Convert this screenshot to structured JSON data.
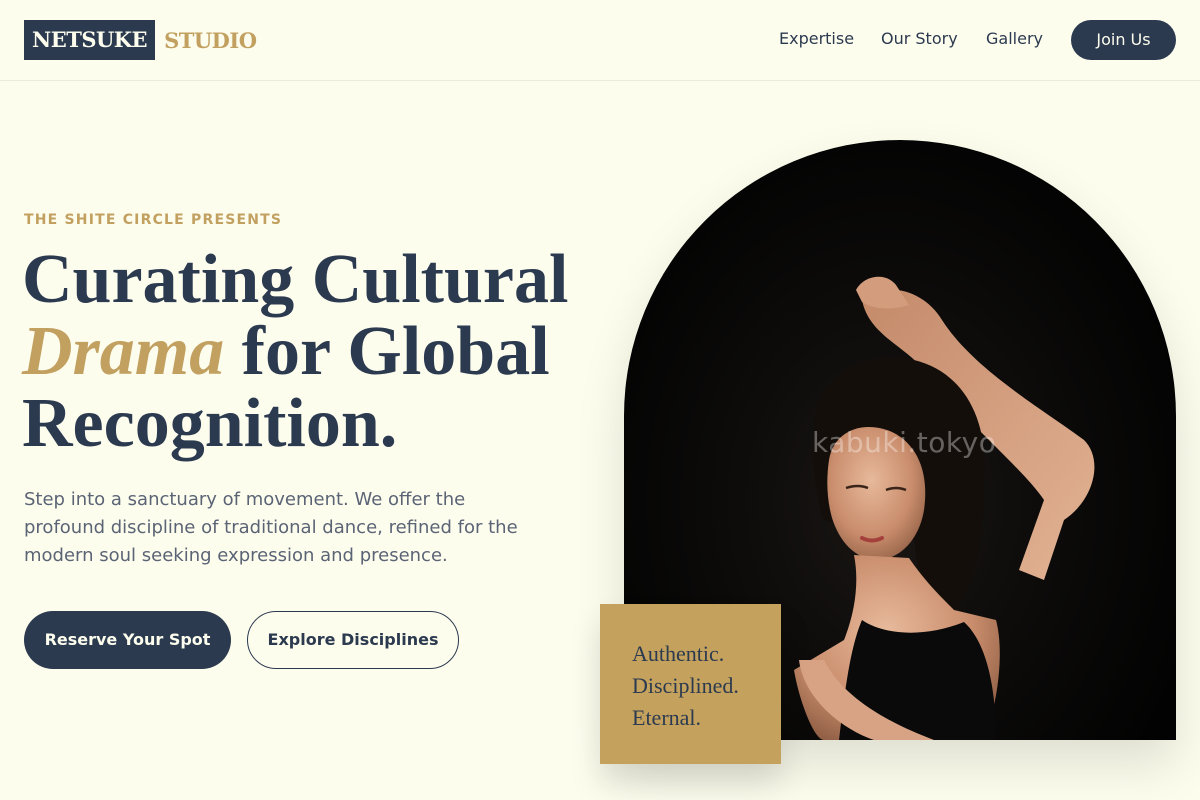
{
  "brand": {
    "mark": "NETSUKE",
    "name": "STUDIO"
  },
  "nav": {
    "links": [
      "Expertise",
      "Our Story",
      "Gallery"
    ],
    "cta": "Join Us"
  },
  "hero": {
    "eyebrow": "THE SHITE CIRCLE PRESENTS",
    "headline": {
      "line1": "Curating Cultural",
      "accent": "Drama",
      "line2_rest": " for Global",
      "line3": "Recognition."
    },
    "lede": "Step into a sanctuary of movement. We offer the profound discipline of traditional dance, refined for the modern soul seeking expression and presence.",
    "primary_cta": "Reserve Your Spot",
    "secondary_cta": "Explore Disciplines"
  },
  "image": {
    "watermark": "kabuki.tokyo",
    "subject": "dancer-photo"
  },
  "quote": {
    "lines": [
      "Authentic.",
      "Disciplined.",
      "Eternal."
    ]
  },
  "colors": {
    "background": "#fdfdee",
    "navy": "#2c3a50",
    "gold": "#c2a060"
  }
}
